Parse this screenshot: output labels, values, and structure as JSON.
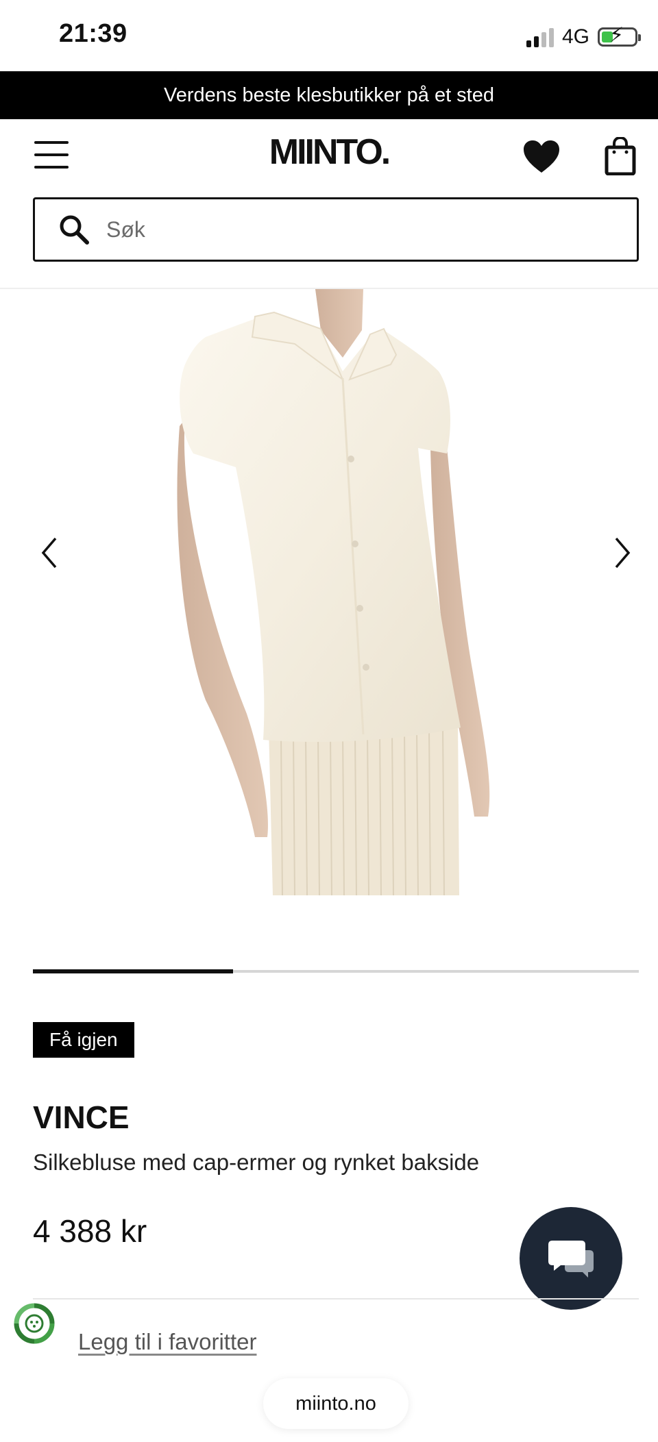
{
  "status_bar": {
    "time": "21:39",
    "network": "4G"
  },
  "promo_banner": {
    "text": "Verdens beste klesbutikker på et sted"
  },
  "header": {
    "logo": "MIINTO."
  },
  "search": {
    "placeholder": "Søk"
  },
  "gallery": {
    "progress": 0.33
  },
  "product": {
    "badge": "Få igjen",
    "brand": "VINCE",
    "title": "Silkebluse med cap-ermer og rynket bakside",
    "price": "4 388 kr"
  },
  "favorites_link": "Legg til i favoritter",
  "browser": {
    "url": "miinto.no"
  },
  "colors": {
    "banner": "#000000",
    "chat_button": "#1d2736",
    "battery_charge": "#3ec24a"
  },
  "icons": [
    "menu-icon",
    "heart-icon",
    "shopping-bag-icon",
    "search-icon",
    "chevron-left-icon",
    "chevron-right-icon",
    "chat-icon",
    "eco-icon"
  ]
}
